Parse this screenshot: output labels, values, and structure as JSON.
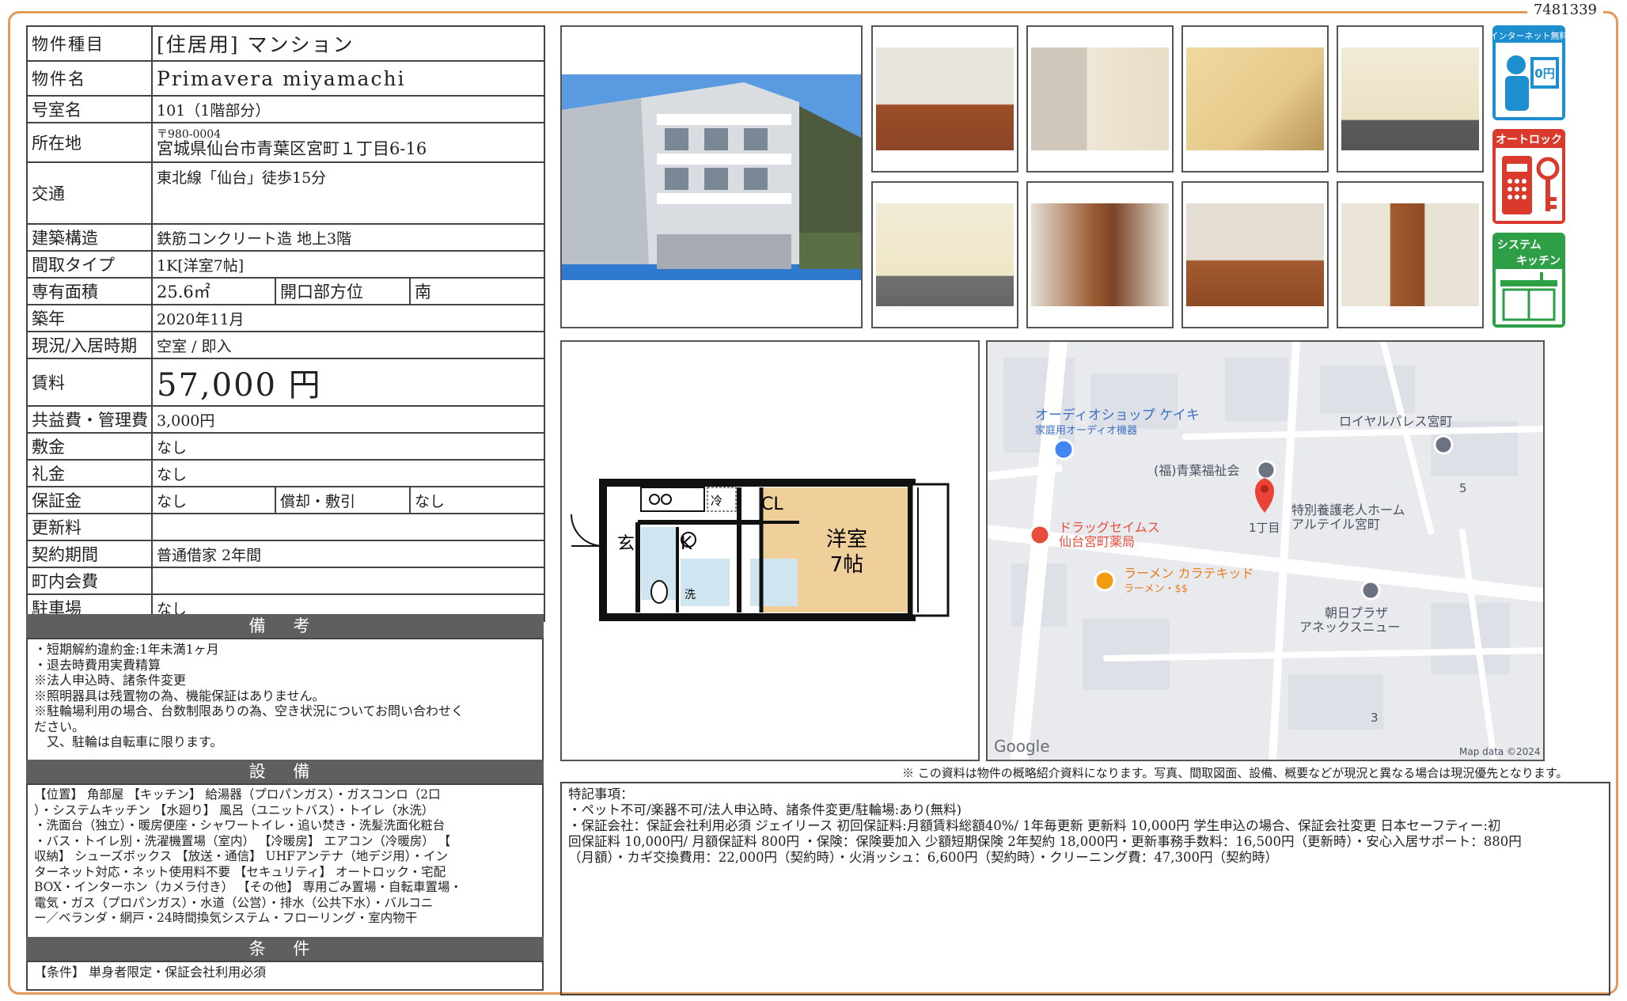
{
  "doc_number": "7481339",
  "property": {
    "type_label": "物件種目",
    "type_value": "[住居用]  マンション",
    "name_label": "物件名",
    "name_value": "Primavera  miyamachi",
    "room_label": "号室名",
    "room_value": "101（1階部分）",
    "address_label": "所在地",
    "address_zip": "〒980-0004",
    "address_value": "宮城県仙台市青葉区宮町１丁目6-16",
    "access_label": "交通",
    "access_value": "東北線「仙台」徒歩15分",
    "structure_label": "建築構造",
    "structure_value": "鉄筋コンクリート造 地上3階",
    "layout_label": "間取タイプ",
    "layout_value": "1K[洋室7帖]",
    "area_label": "専有面積",
    "area_value": "25.6㎡",
    "direction_label": "開口部方位",
    "direction_value": "南",
    "built_label": "築年",
    "built_value": "2020年11月",
    "status_label": "現況/入居時期",
    "status_value": "空室 / 即入",
    "rent_label": "賃料",
    "rent_value": "57,000 円",
    "fee_label": "共益費・管理費",
    "fee_value": "3,000円",
    "deposit_label": "敷金",
    "deposit_value": "なし",
    "keymoney_label": "礼金",
    "keymoney_value": "なし",
    "guarantee_label": "保証金",
    "guarantee_value": "なし",
    "amort_label": "償却・敷引",
    "amort_value": "なし",
    "renewal_label": "更新料",
    "renewal_value": "",
    "contract_label": "契約期間",
    "contract_value": "普通借家 2年間",
    "community_label": "町内会費",
    "community_value": "",
    "parking_label": "駐車場",
    "parking_value": "なし"
  },
  "remarks": {
    "title": "備 考",
    "lines": [
      "・短期解約違約金:1年未満1ヶ月",
      "・退去時費用実費精算",
      "※法人申込時、諸条件変更",
      "※照明器具は残置物の為、機能保証はありません。",
      "※駐輪場利用の場合、台数制限ありの為、空き状況についてお問い合わせく",
      "ださい。",
      "　又、駐輪は自転車に限ります。"
    ]
  },
  "equipment": {
    "title": "設 備",
    "lines": [
      "【位置】 角部屋 【キッチン】 給湯器（プロパンガス）・ガスコンロ（2口",
      "）・システムキッチン 【水廻り】 風呂（ユニットバス）・トイレ（水洗）",
      "・洗面台（独立）・暖房便座・シャワートイレ・追い焚き・洗髪洗面化粧台",
      "・バス・トイレ別・洗濯機置場（室内） 【冷暖房】 エアコン（冷暖房） 【",
      "収納】 シューズボックス 【放送・通信】 UHFアンテナ（地デジ用）・イン",
      "ターネット対応・ネット使用料不要 【セキュリティ】 オートロック・宅配",
      "BOX・インターホン（カメラ付き） 【その他】 専用ごみ置場・自転車置場・",
      "電気・ガス（プロパンガス）・水道（公営）・排水（公共下水）・バルコニ",
      "ー／ベランダ・網戸・24時間換気システム・フローリング・室内物干"
    ]
  },
  "conditions": {
    "title": "条 件",
    "lines": [
      "【条件】 単身者限定・保証会社利用必須"
    ]
  },
  "icons": [
    {
      "name": "internet-free-icon",
      "title": "インターネット無料",
      "badge": "0円",
      "color": "#1d8fd0"
    },
    {
      "name": "auto-lock-icon",
      "title": "オートロック",
      "color": "#d93a2b"
    },
    {
      "name": "system-kitchen-icon",
      "title": "システム キッチン",
      "color": "#2e9e47"
    }
  ],
  "floorplan": {
    "entrance": "玄",
    "kitchen": "K",
    "fridge": "冷",
    "closet": "CL",
    "room_name": "洋室",
    "room_size": "7帖",
    "laundry": "洗"
  },
  "map": {
    "places": [
      {
        "label": "オーディオショップ ケイキ",
        "sub": "家庭用オーディオ機器"
      },
      {
        "label": "(福)青葉福祉会"
      },
      {
        "label": "ロイヤルパレス宮町"
      },
      {
        "label": "ドラッグセイムス",
        "sub": "仙台宮町薬局"
      },
      {
        "label": "特別養護老人ホーム",
        "sub": "アルテイル宮町"
      },
      {
        "label": "ラーメン カラテキッド",
        "sub": "ラーメン・$$"
      },
      {
        "label": "朝日プラザ",
        "sub": "アネックスニュー"
      }
    ],
    "pin_label": "1丁目",
    "block_numbers": [
      "5",
      "3"
    ],
    "google": "Google",
    "attribution": "Map data ©2024"
  },
  "disclaimer": "※ この資料は物件の概略紹介資料になります。写真、間取図面、設備、概要などが現況と異なる場合は現況優先となります。",
  "special_notes": {
    "lines": [
      "特記事項：",
      "・ペット不可/楽器不可/法人申込時、諸条件変更/駐輪場:あり(無料)",
      "・保証会社：保証会社利用必須 ジェイリース 初回保証料:月額賃料総額40%/ 1年毎更新 更新料 10,000円 学生申込の場合、保証会社変更 日本セーフティー:初",
      "回保証料 10,000円/ 月額保証料 800円 ・保険：保険要加入 少額短期保険 2年契約 18,000円・更新事務手数料：16,500円（更新時）・安心入居サポート：880円",
      "（月額）・カギ交換費用：22,000円（契約時）・火消ッシュ：6,600円（契約時）・クリーニング費：47,300円（契約時）"
    ]
  }
}
